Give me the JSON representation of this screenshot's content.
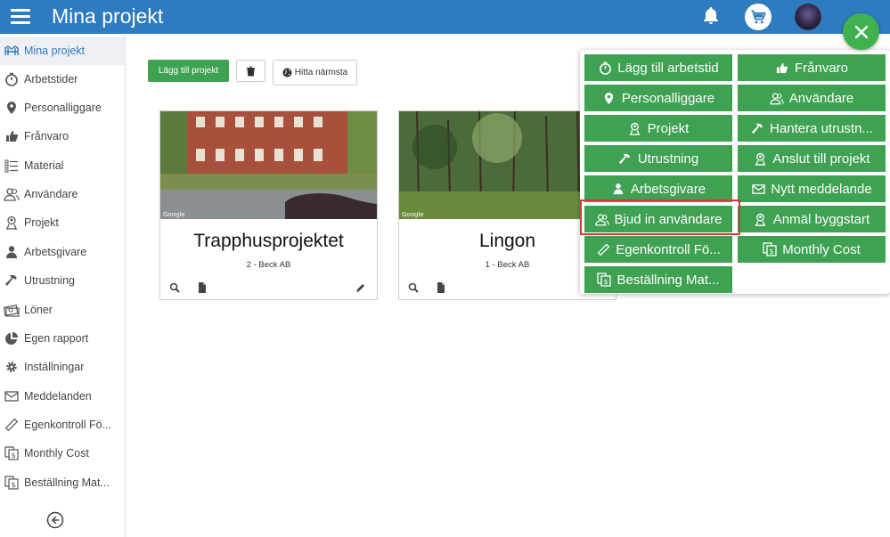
{
  "header": {
    "title": "Mina projekt"
  },
  "sidebar": {
    "items": [
      {
        "label": "Mina projekt",
        "icon": "projects-icon",
        "active": true
      },
      {
        "label": "Arbetstider",
        "icon": "stopwatch-icon"
      },
      {
        "label": "Personalliggare",
        "icon": "map-pin-icon"
      },
      {
        "label": "Frånvaro",
        "icon": "thumb-icon"
      },
      {
        "label": "Material",
        "icon": "list-icon"
      },
      {
        "label": "Användare",
        "icon": "users-icon"
      },
      {
        "label": "Projekt",
        "icon": "location-person-icon"
      },
      {
        "label": "Arbetsgivare",
        "icon": "person-icon"
      },
      {
        "label": "Utrustning",
        "icon": "hammer-icon"
      },
      {
        "label": "Löner",
        "icon": "money-icon"
      },
      {
        "label": "Egen rapport",
        "icon": "pie-chart-icon"
      },
      {
        "label": "Inställningar",
        "icon": "gear-icon"
      },
      {
        "label": "Meddelanden",
        "icon": "envelope-icon"
      },
      {
        "label": "Egenkontroll Fö...",
        "icon": "ruler-icon"
      },
      {
        "label": "Monthly Cost",
        "icon": "copy-dollar-icon"
      },
      {
        "label": "Beställning Mat...",
        "icon": "copy-dollar-icon"
      }
    ]
  },
  "toolbar": {
    "add_label": "Lägg till projekt",
    "nearest_label": "Hitta närmsta"
  },
  "projects": [
    {
      "title": "Trapphusprojektet",
      "subtitle": "2 - Beck AB"
    },
    {
      "title": "Lingon",
      "subtitle": "1 - Beck AB"
    }
  ],
  "photo_credit": "Google",
  "quick_menu": {
    "items": [
      {
        "label": "Lägg till arbetstid",
        "icon": "stopwatch-icon"
      },
      {
        "label": "Frånvaro",
        "icon": "thumb-icon"
      },
      {
        "label": "Personalliggare",
        "icon": "map-pin-icon"
      },
      {
        "label": "Användare",
        "icon": "users-icon"
      },
      {
        "label": "Projekt",
        "icon": "location-person-icon"
      },
      {
        "label": "Hantera utrustn...",
        "icon": "hammer-icon"
      },
      {
        "label": "Utrustning",
        "icon": "hammer-icon"
      },
      {
        "label": "Anslut till projekt",
        "icon": "location-person-icon"
      },
      {
        "label": "Arbetsgivare",
        "icon": "person-icon"
      },
      {
        "label": "Nytt meddelande",
        "icon": "envelope-icon"
      },
      {
        "label": "Bjud in användare",
        "icon": "users-icon"
      },
      {
        "label": "Anmäl byggstart",
        "icon": "location-person-icon"
      },
      {
        "label": "Egenkontroll Fö...",
        "icon": "ruler-icon"
      },
      {
        "label": "Monthly Cost",
        "icon": "copy-dollar-icon"
      },
      {
        "label": "Beställning Mat...",
        "icon": "copy-dollar-icon"
      }
    ],
    "highlighted": "Bjud in användare"
  },
  "colors": {
    "topbar": "#2f7bbf",
    "accent_green": "#3fa152",
    "highlight": "#d23a3a"
  }
}
